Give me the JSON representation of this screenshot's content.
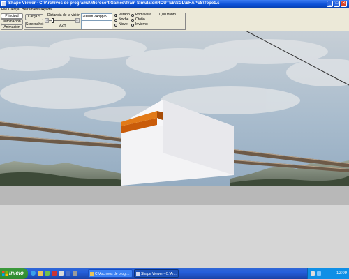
{
  "window": {
    "title": "Shape Viewer - C:\\Archivos de programa\\Microsoft Games\\Train Simulator\\ROUTES\\SGL\\SHAPES\\Tope1.s",
    "minimize": "_",
    "maximize": "□",
    "close": "✕"
  },
  "menu": [
    "File",
    "Cientja",
    "Herramientas",
    "Ayuda"
  ],
  "toolbar": {
    "tabs": [
      "Principal",
      "Iluminación",
      "Animación"
    ],
    "load_button": "Carga S",
    "screenshot_button": "Screenshot",
    "distance_label": "Distancia de la visión",
    "distance_value": "9,2m",
    "resolution_value": "2000m 24bpp/tv",
    "seasons": [
      {
        "label": "Verano",
        "selected": true
      },
      {
        "label": "Primavera",
        "selected": false
      },
      {
        "label": "Noche",
        "selected": false
      },
      {
        "label": "Otoño",
        "selected": false
      },
      {
        "label": "Nieve",
        "selected": false
      },
      {
        "label": "Invierno",
        "selected": false
      }
    ],
    "fps": "0,00 frabm"
  },
  "taskbar": {
    "start": "Inicio",
    "tasks": [
      {
        "label": "C:\\Archivos de progr...",
        "active": false
      },
      {
        "label": "Shape Viewer - C:\\Ar...",
        "active": true
      }
    ],
    "clock": "12:09"
  },
  "colors": {
    "sky": "#aebfcf",
    "ground": "#d7d7d7",
    "bumper_top": "#d96a10",
    "block": "#f3f3f5"
  }
}
